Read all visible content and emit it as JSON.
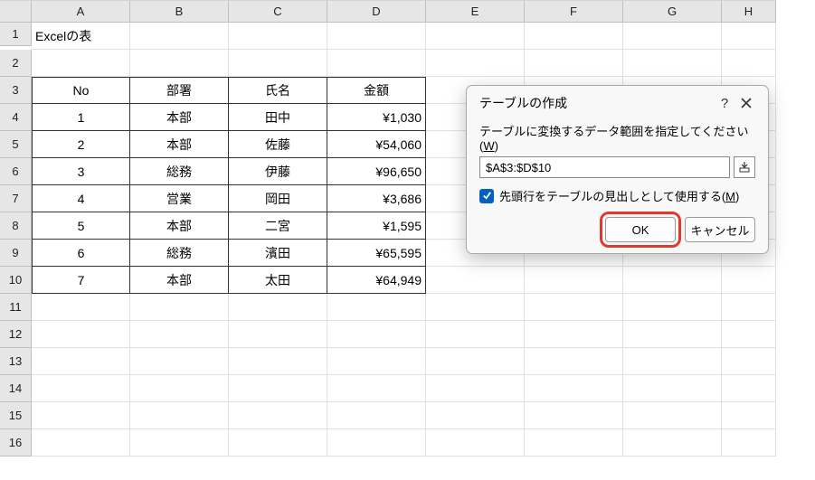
{
  "columns": [
    "A",
    "B",
    "C",
    "D",
    "E",
    "F",
    "G",
    "H"
  ],
  "rows": [
    "1",
    "2",
    "3",
    "4",
    "5",
    "6",
    "7",
    "8",
    "9",
    "10",
    "11",
    "12",
    "13",
    "14",
    "15",
    "16"
  ],
  "title_cell": "Excelの表",
  "table": {
    "headers": [
      "No",
      "部署",
      "氏名",
      "金額"
    ],
    "rows": [
      {
        "no": "1",
        "dept": "本部",
        "name": "田中",
        "amount": "¥1,030"
      },
      {
        "no": "2",
        "dept": "本部",
        "name": "佐藤",
        "amount": "¥54,060"
      },
      {
        "no": "3",
        "dept": "総務",
        "name": "伊藤",
        "amount": "¥96,650"
      },
      {
        "no": "4",
        "dept": "営業",
        "name": "岡田",
        "amount": "¥3,686"
      },
      {
        "no": "5",
        "dept": "本部",
        "name": "二宮",
        "amount": "¥1,595"
      },
      {
        "no": "6",
        "dept": "総務",
        "name": "濱田",
        "amount": "¥65,595"
      },
      {
        "no": "7",
        "dept": "本部",
        "name": "太田",
        "amount": "¥64,949"
      }
    ]
  },
  "dialog": {
    "title": "テーブルの作成",
    "help": "?",
    "prompt_pre": "テーブルに変換するデータ範囲を指定してください(",
    "prompt_u": "W",
    "prompt_post": ")",
    "range": "$A$3:$D$10",
    "checkbox_pre": "先頭行をテーブルの見出しとして使用する(",
    "checkbox_u": "M",
    "checkbox_post": ")",
    "ok": "OK",
    "cancel": "キャンセル"
  },
  "chart_data": {
    "type": "table",
    "title": "Excelの表",
    "columns": [
      "No",
      "部署",
      "氏名",
      "金額"
    ],
    "rows": [
      [
        1,
        "本部",
        "田中",
        1030
      ],
      [
        2,
        "本部",
        "佐藤",
        54060
      ],
      [
        3,
        "総務",
        "伊藤",
        96650
      ],
      [
        4,
        "営業",
        "岡田",
        3686
      ],
      [
        5,
        "本部",
        "二宮",
        1595
      ],
      [
        6,
        "総務",
        "濱田",
        65595
      ],
      [
        7,
        "本部",
        "太田",
        64949
      ]
    ]
  }
}
